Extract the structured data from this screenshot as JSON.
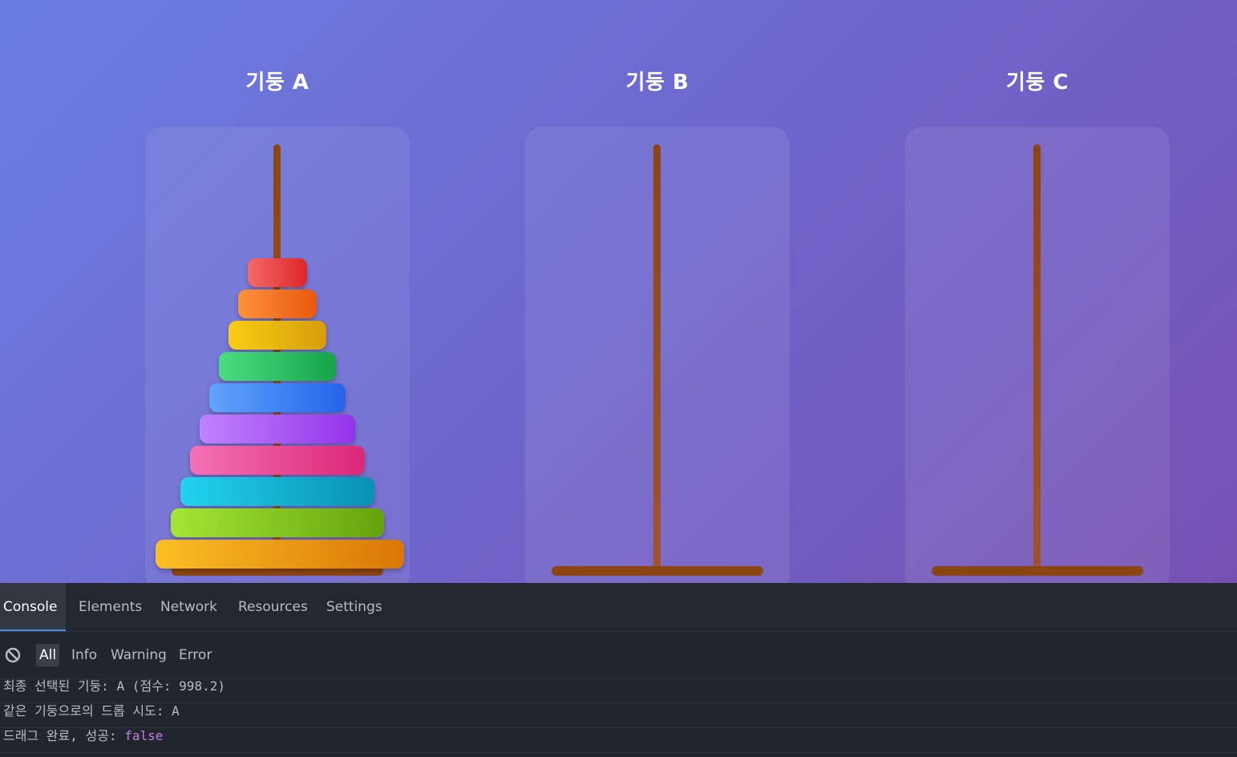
{
  "pegs": [
    {
      "title": "기둥 A",
      "disk_count": 10
    },
    {
      "title": "기둥 B",
      "disk_count": 0
    },
    {
      "title": "기둥 C",
      "disk_count": 0
    }
  ],
  "disks": [
    {
      "size": 1,
      "colors": [
        "#f46a6a",
        "#dc2626"
      ]
    },
    {
      "size": 2,
      "colors": [
        "#fb923c",
        "#ea580c"
      ]
    },
    {
      "size": 3,
      "colors": [
        "#facc15",
        "#d69e0a"
      ]
    },
    {
      "size": 4,
      "colors": [
        "#4ade80",
        "#16a34a"
      ]
    },
    {
      "size": 5,
      "colors": [
        "#60a5fa",
        "#2563eb"
      ]
    },
    {
      "size": 6,
      "colors": [
        "#c084fc",
        "#9333ea"
      ]
    },
    {
      "size": 7,
      "colors": [
        "#f472b6",
        "#db2777"
      ]
    },
    {
      "size": 8,
      "colors": [
        "#22d3ee",
        "#0891b2"
      ]
    },
    {
      "size": 9,
      "colors": [
        "#a3e635",
        "#65a30d"
      ]
    },
    {
      "size": 10,
      "colors": [
        "#fbbf24",
        "#d97706"
      ]
    }
  ],
  "devtools": {
    "tabs": [
      "Console",
      "Elements",
      "Network",
      "Resources",
      "Settings"
    ],
    "active_tab": "Console",
    "filters": [
      "All",
      "Info",
      "Warning",
      "Error"
    ],
    "active_filter": "All",
    "logs": [
      {
        "text": "최종 선택된 기둥: A (점수: 998.2)"
      },
      {
        "text": "같은 기둥으로의 드롭 시도: A"
      },
      {
        "text": "드래그 완료, 성공: ",
        "value": "false"
      }
    ]
  },
  "colors": {
    "rod": "#8b4513",
    "devtools_bg": "#21252c",
    "bool": "#c57ae8"
  }
}
